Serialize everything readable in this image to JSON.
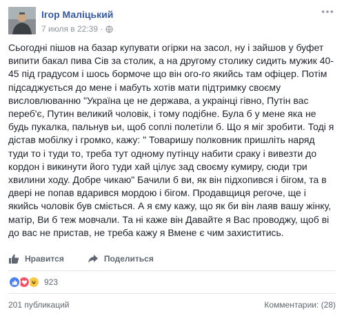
{
  "post": {
    "author": "Ігор Маліцький",
    "timestamp": "7 июля в 22:39 ·",
    "text": "Сьогодні пішов на базар купувати огірки на засол, ну і зайшов у буфет випити бакал пива Сів за столик, а на другому столику сидить мужик 40-45 під градусом і шось бормоче що він ого-го якийсь там офіцер. Потім підсаджується до мене і мабуть хотів мати підтримку своєму висловлюванню \"Україна це не держава, а украінці гівно, Путін вас переб'є, Путин великий чоловік, і тому подібне. Була б у мене яка не будь пукалка, пальнув ьи, щоб соплі полетіли б. Що я міг зробити. Тоді я дістав мобілку і громко, кажу: \" Товаришу полковник пришліть наряд туди то і туди то, треба тут одному путінцу набити сраку і вивезти до кордон і викинути його туди хай цілує зад своєму кумиру, сюди три хвилини ходу. Добре чикаю\" Бачили б ви, як він підхопився і бігом, та в двері не попав вдарився мордою і бігом. Продавщиця регоче, ще і якийсь чоловік був сміється. А я єму кажу, що як би він лаяв вашу жінку, матір, Ви б теж мовчали. Та ні каже він Давайте я Вас проводжу, щоб ві до вас не пристав, не треба кажу я Вмене є чим захиститись."
  },
  "actions": {
    "like_label": "Нравится",
    "share_label": "Поделиться"
  },
  "reactions": {
    "types": [
      "like-icon",
      "love-icon",
      "haha-icon"
    ],
    "count": "923"
  },
  "footer": {
    "shares": "201 публикаций",
    "comments": "Комментарии: (28)"
  },
  "colors": {
    "author_link": "#365899",
    "secondary_text": "#606770",
    "meta_text": "#90949c"
  }
}
